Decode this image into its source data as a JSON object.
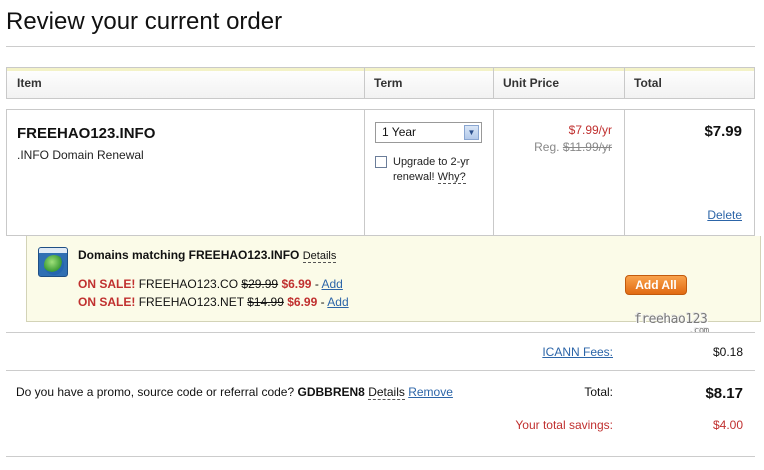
{
  "page": {
    "title": "Review your current order"
  },
  "table": {
    "headers": {
      "item": "Item",
      "term": "Term",
      "unit_price": "Unit Price",
      "total": "Total"
    }
  },
  "order_item": {
    "domain": "FREEHAO123.INFO",
    "description": ".INFO Domain Renewal",
    "term_selected": "1 Year",
    "upgrade_text_1": "Upgrade to 2-yr",
    "upgrade_text_2": "renewal!",
    "why_link": "Why?",
    "sale_price": "$7.99/yr",
    "reg_label": "Reg.",
    "reg_price": "$11.99/yr",
    "total": "$7.99",
    "delete_label": "Delete"
  },
  "suggestions": {
    "title": "Domains matching FREEHAO123.INFO",
    "details_label": "Details",
    "items": [
      {
        "sale_label": "ON SALE!",
        "domain": "FREEHAO123.CO",
        "old_price": "$29.99",
        "new_price": "$6.99",
        "sep": "-",
        "add_label": "Add"
      },
      {
        "sale_label": "ON SALE!",
        "domain": "FREEHAO123.NET",
        "old_price": "$14.99",
        "new_price": "$6.99",
        "sep": "-",
        "add_label": "Add"
      }
    ],
    "add_all_label": "Add All"
  },
  "watermark": {
    "text": "freehao123",
    "sub": ".com"
  },
  "summary": {
    "icann_label": "ICANN Fees:",
    "icann_value": "$0.18",
    "promo_question": "Do you have a promo, source code or referral code?",
    "promo_code": "GDBBREN8",
    "promo_details": "Details",
    "promo_remove": "Remove",
    "total_label": "Total:",
    "total_value": "$8.17",
    "savings_label": "Your total savings:",
    "savings_value": "$4.00"
  },
  "colors": {
    "sale_red": "#c0302f",
    "link_blue": "#2c65a8",
    "add_all_orange": "#e16a12",
    "suggest_bg": "#fbfbe8"
  },
  "icons": {
    "suggest": "globe-window-icon",
    "select_arrow": "chevron-down-icon"
  }
}
